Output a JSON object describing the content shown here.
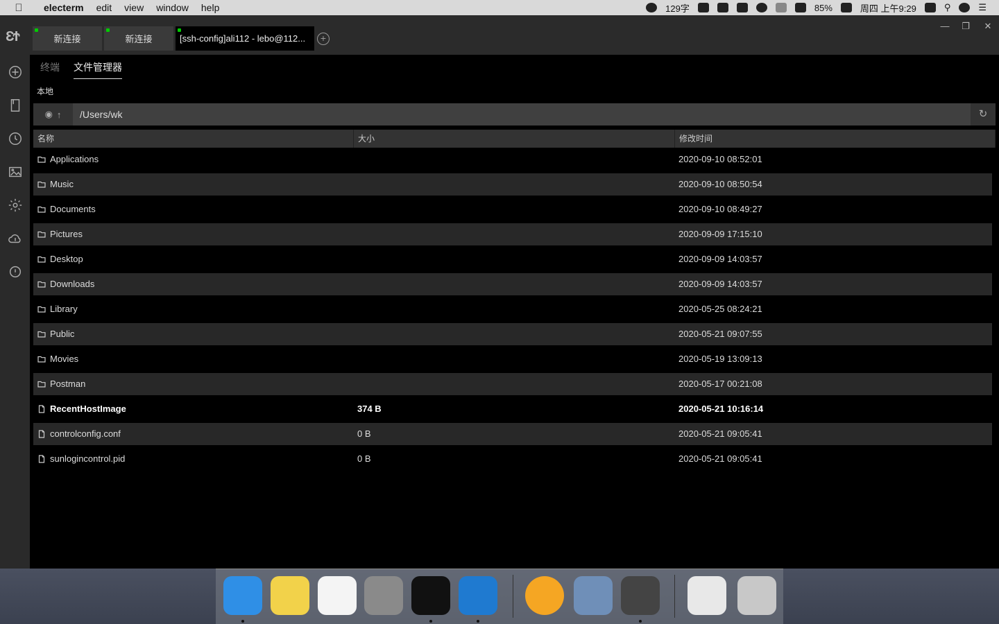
{
  "menubar": {
    "app_name": "electerm",
    "menus": [
      "edit",
      "view",
      "window",
      "help"
    ],
    "char_count": "129字",
    "battery": "85%",
    "clock": "周四 上午9:29"
  },
  "tabs": [
    {
      "label": "新连接"
    },
    {
      "label": "新连接"
    },
    {
      "label": "[ssh-config]ali112 - lebo@112..."
    }
  ],
  "subtabs": {
    "terminal": "终端",
    "file_manager": "文件管理器"
  },
  "section_label": "本地",
  "path": "/Users/wk",
  "columns": {
    "name": "名称",
    "size": "大小",
    "mtime": "修改时间"
  },
  "files": [
    {
      "name": "Applications",
      "size": "",
      "mtime": "2020-09-10 08:52:01",
      "type": "folder"
    },
    {
      "name": "Music",
      "size": "",
      "mtime": "2020-09-10 08:50:54",
      "type": "folder"
    },
    {
      "name": "Documents",
      "size": "",
      "mtime": "2020-09-10 08:49:27",
      "type": "folder"
    },
    {
      "name": "Pictures",
      "size": "",
      "mtime": "2020-09-09 17:15:10",
      "type": "folder"
    },
    {
      "name": "Desktop",
      "size": "",
      "mtime": "2020-09-09 14:03:57",
      "type": "folder"
    },
    {
      "name": "Downloads",
      "size": "",
      "mtime": "2020-09-09 14:03:57",
      "type": "folder"
    },
    {
      "name": "Library",
      "size": "",
      "mtime": "2020-05-25 08:24:21",
      "type": "folder"
    },
    {
      "name": "Public",
      "size": "",
      "mtime": "2020-05-21 09:07:55",
      "type": "folder"
    },
    {
      "name": "Movies",
      "size": "",
      "mtime": "2020-05-19 13:09:13",
      "type": "folder"
    },
    {
      "name": "Postman",
      "size": "",
      "mtime": "2020-05-17 00:21:08",
      "type": "folder"
    },
    {
      "name": "RecentHostImage",
      "size": "374 B",
      "mtime": "2020-05-21 10:16:14",
      "type": "file"
    },
    {
      "name": "controlconfig.conf",
      "size": "0 B",
      "mtime": "2020-05-21 09:05:41",
      "type": "file"
    },
    {
      "name": "sunlogincontrol.pid",
      "size": "0 B",
      "mtime": "2020-05-21 09:05:41",
      "type": "file"
    }
  ],
  "colors": {
    "sidebar": "#2a2a2a",
    "row_alt": "#282828",
    "path_bg": "#404040",
    "tab_dot": "#00cc00"
  },
  "dock_apps": [
    "finder-icon",
    "notes-icon",
    "reminders-icon",
    "system-preferences-icon",
    "terminal-icon",
    "edge-icon",
    "app-icon",
    "preview-icon",
    "electerm-icon",
    "archive-icon",
    "trash-icon"
  ]
}
